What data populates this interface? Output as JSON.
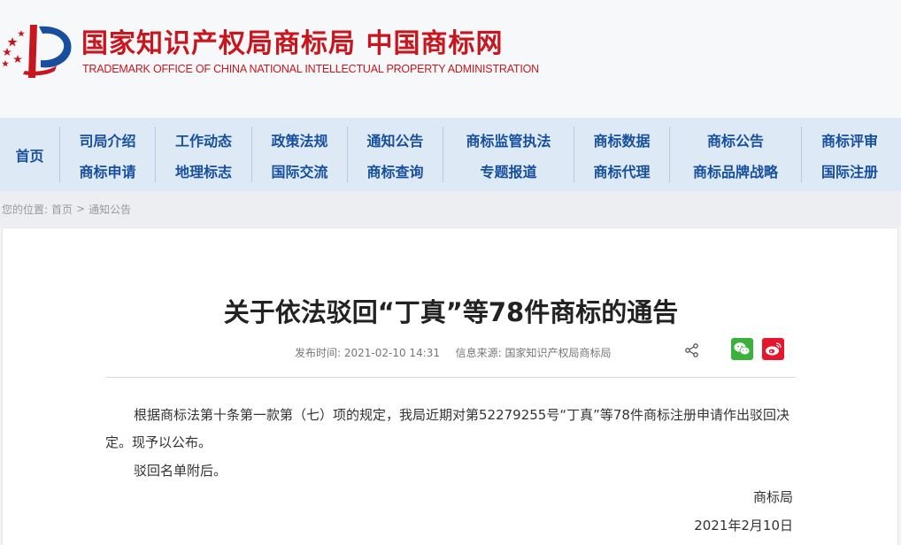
{
  "header": {
    "site_name_cn": "国家知识产权局商标局 中国商标网",
    "site_name_en": "TRADEMARK OFFICE OF CHINA NATIONAL INTELLECTUAL PROPERTY ADMINISTRATION",
    "brand_color": "#c8161e"
  },
  "nav": {
    "home": "首页",
    "columns": [
      {
        "top": "司局介绍",
        "bottom": "商标申请"
      },
      {
        "top": "工作动态",
        "bottom": "地理标志"
      },
      {
        "top": "政策法规",
        "bottom": "国际交流"
      },
      {
        "top": "通知公告",
        "bottom": "商标查询"
      },
      {
        "top": "商标监管执法",
        "bottom": "专题报道"
      },
      {
        "top": "商标数据",
        "bottom": "商标代理"
      },
      {
        "top": "商标公告",
        "bottom": "商标品牌战略"
      },
      {
        "top": "商标评审",
        "bottom": "国际注册"
      }
    ],
    "text_color": "#174f9e"
  },
  "breadcrumb": {
    "prefix": "您的位置:",
    "home": "首页",
    "separator": ">",
    "current": "通知公告"
  },
  "article": {
    "title": "关于依法驳回“丁真”等78件商标的通告",
    "publish_label": "发布时间:",
    "publish_time": "2021-02-10 14:31",
    "source_label": "信息来源:",
    "source": "国家知识产权局商标局",
    "paragraph1": "根据商标法第十条第一款第（七）项的规定，我局近期对第52279255号“丁真”等78件商标注册申请作出驳回决定。现予以公布。",
    "paragraph2": "驳回名单附后。",
    "signature": "商标局",
    "date": "2021年2月10日"
  },
  "icons": {
    "share": "share-icon",
    "wechat": "wechat-icon",
    "weibo": "weibo-icon"
  }
}
